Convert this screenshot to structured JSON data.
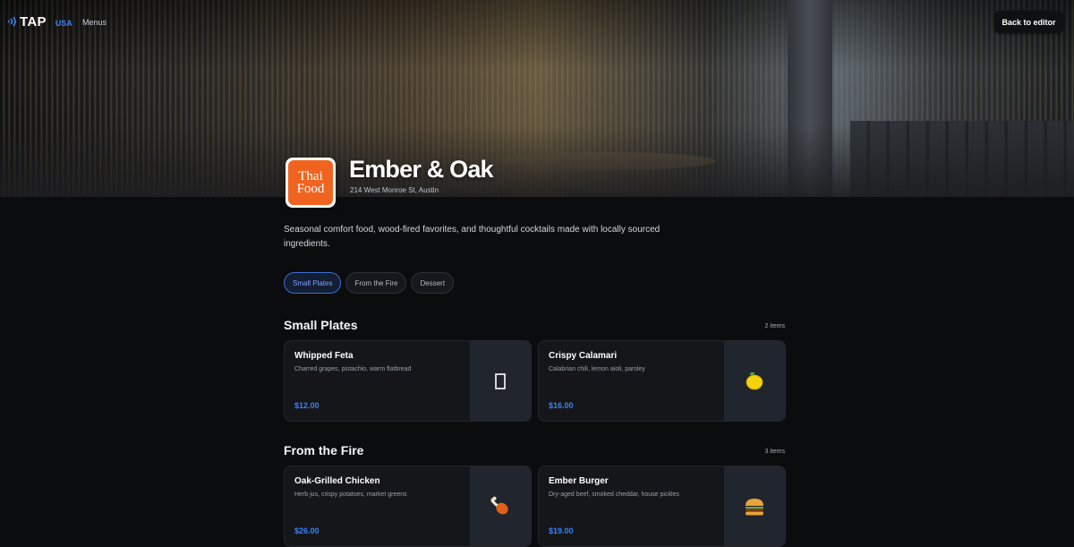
{
  "brand": {
    "name": "TAP",
    "region": "USA"
  },
  "nav": {
    "menus_label": "Menus"
  },
  "back_button": "Back to editor",
  "logo": {
    "line1": "Thai",
    "line2": "Food"
  },
  "restaurant": {
    "name": "Ember & Oak",
    "address": "214 West Monroe St, Austin",
    "description": "Seasonal comfort food, wood-fired favorites, and thoughtful cocktails made with locally sourced ingredients."
  },
  "tabs": [
    {
      "label": "Small Plates",
      "active": true
    },
    {
      "label": "From the Fire",
      "active": false
    },
    {
      "label": "Dessert",
      "active": false
    }
  ],
  "sections": [
    {
      "title": "Small Plates",
      "count": "2 items",
      "items": [
        {
          "name": "Whipped Feta",
          "description": "Charred grapes, pistachio, warm flatbread",
          "price": "$12.00",
          "icon": "placeholder-glyph-icon"
        },
        {
          "name": "Crispy Calamari",
          "description": "Calabrian chili, lemon aioli, parsley",
          "price": "$16.00",
          "icon": "lemon-icon"
        }
      ]
    },
    {
      "title": "From the Fire",
      "count": "3 items",
      "items": [
        {
          "name": "Oak-Grilled Chicken",
          "description": "Herb jus, crispy potatoes, market greens",
          "price": "$26.00",
          "icon": "drumstick-icon"
        },
        {
          "name": "Ember Burger",
          "description": "Dry-aged beef, smoked cheddar, house pickles",
          "price": "$19.00",
          "icon": "burger-icon"
        }
      ]
    }
  ],
  "colors": {
    "accent": "#3b82f6",
    "logo_bg": "#f1641f",
    "background": "#0b0c0e",
    "card": "#141619"
  }
}
